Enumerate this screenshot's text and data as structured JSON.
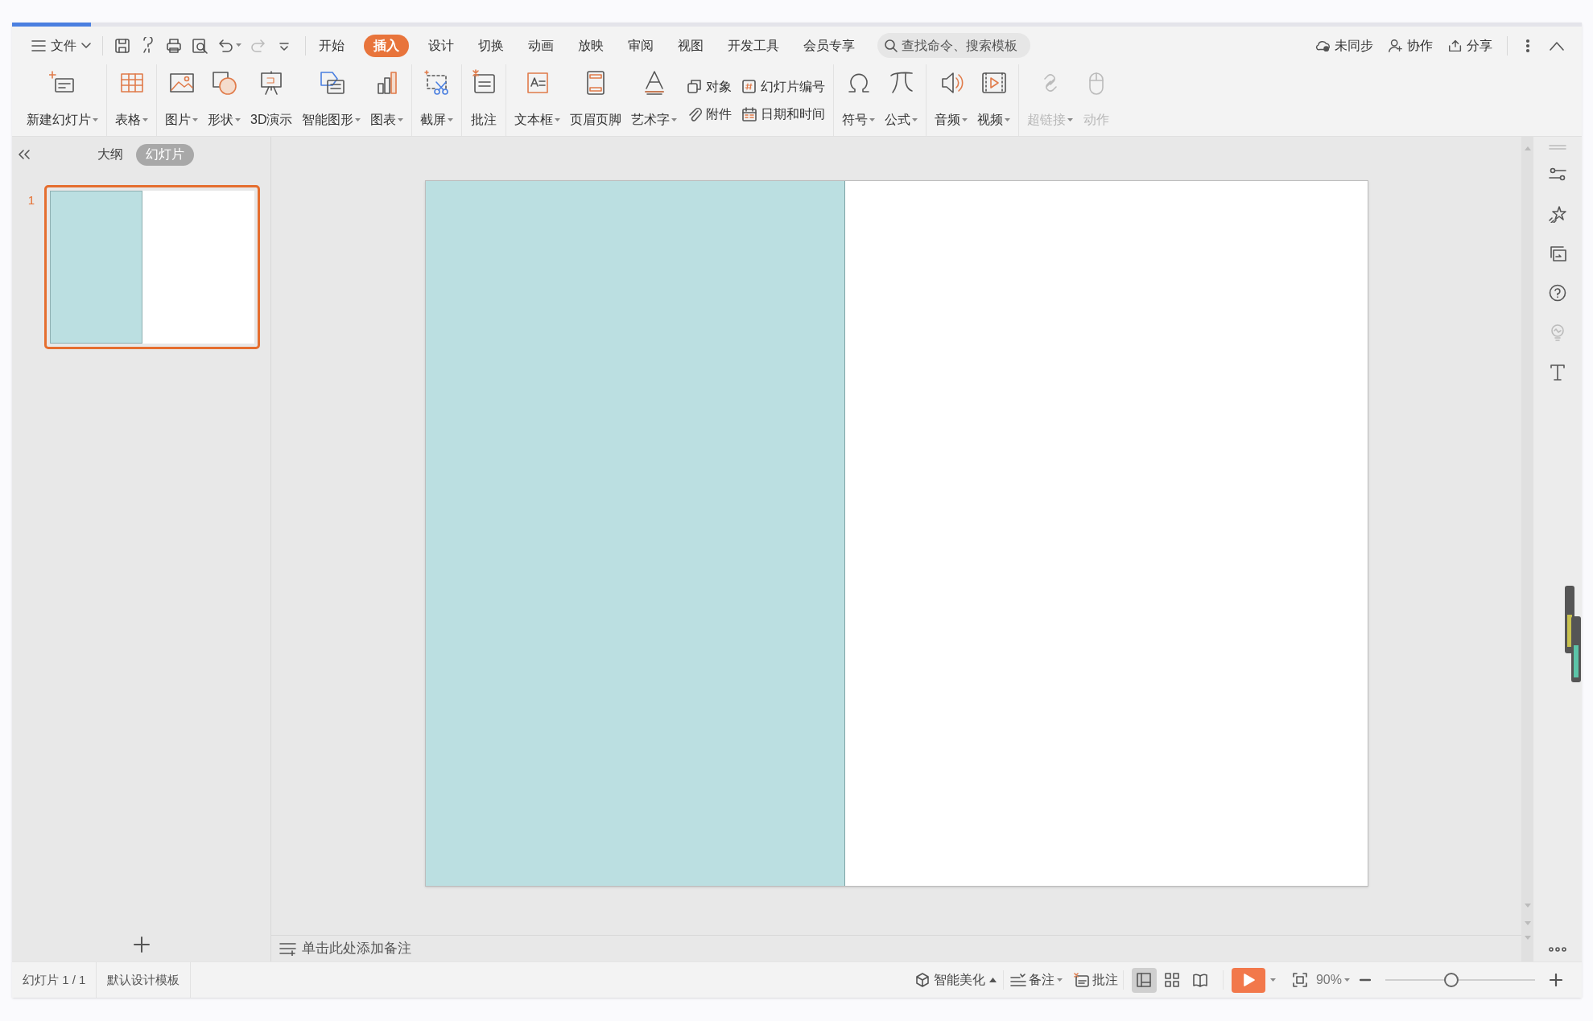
{
  "menu": {
    "file_label": "文件",
    "tabs": [
      {
        "label": "开始",
        "selected": false
      },
      {
        "label": "插入",
        "selected": true
      },
      {
        "label": "设计",
        "selected": false
      },
      {
        "label": "切换",
        "selected": false
      },
      {
        "label": "动画",
        "selected": false
      },
      {
        "label": "放映",
        "selected": false
      },
      {
        "label": "审阅",
        "selected": false
      },
      {
        "label": "视图",
        "selected": false
      },
      {
        "label": "开发工具",
        "selected": false
      },
      {
        "label": "会员专享",
        "selected": false
      }
    ],
    "search": {
      "placeholder": "查找命令、搜索模板"
    },
    "actions": [
      {
        "label": "未同步"
      },
      {
        "label": "协作"
      },
      {
        "label": "分享"
      }
    ]
  },
  "ribbon": {
    "groups": [
      {
        "items": [
          {
            "label": "新建幻灯片",
            "kind": "large",
            "dropdown": true,
            "disabled": false
          }
        ]
      },
      {
        "items": [
          {
            "label": "表格",
            "kind": "large",
            "dropdown": true,
            "disabled": false
          }
        ]
      },
      {
        "items": [
          {
            "label": "图片",
            "kind": "large",
            "dropdown": true,
            "disabled": false
          },
          {
            "label": "形状",
            "kind": "large",
            "dropdown": true,
            "disabled": false
          },
          {
            "label": "3D演示",
            "kind": "large",
            "dropdown": false,
            "disabled": false
          },
          {
            "label": "智能图形",
            "kind": "large",
            "dropdown": true,
            "disabled": false
          },
          {
            "label": "图表",
            "kind": "large",
            "dropdown": true,
            "disabled": false
          }
        ]
      },
      {
        "items": [
          {
            "label": "截屏",
            "kind": "large",
            "dropdown": true,
            "disabled": false
          }
        ]
      },
      {
        "items": [
          {
            "label": "批注",
            "kind": "large",
            "dropdown": false,
            "disabled": false
          }
        ]
      },
      {
        "items": [
          {
            "label": "文本框",
            "kind": "large",
            "dropdown": true,
            "disabled": false
          },
          {
            "label": "页眉页脚",
            "kind": "large",
            "dropdown": false,
            "disabled": false
          },
          {
            "label": "艺术字",
            "kind": "large",
            "dropdown": true,
            "disabled": false
          },
          {
            "label": "对象",
            "kind": "small",
            "dropdown": false,
            "disabled": false
          },
          {
            "label": "附件",
            "kind": "small",
            "dropdown": false,
            "disabled": false
          },
          {
            "label": "幻灯片编号",
            "kind": "small",
            "dropdown": false,
            "disabled": false
          },
          {
            "label": "日期和时间",
            "kind": "small",
            "dropdown": false,
            "disabled": false
          }
        ]
      },
      {
        "items": [
          {
            "label": "符号",
            "kind": "large",
            "dropdown": true,
            "disabled": false
          },
          {
            "label": "公式",
            "kind": "large",
            "dropdown": true,
            "disabled": false
          }
        ]
      },
      {
        "items": [
          {
            "label": "音频",
            "kind": "large",
            "dropdown": true,
            "disabled": false
          },
          {
            "label": "视频",
            "kind": "large",
            "dropdown": true,
            "disabled": false
          }
        ]
      },
      {
        "items": [
          {
            "label": "超链接",
            "kind": "large",
            "dropdown": true,
            "disabled": true
          },
          {
            "label": "动作",
            "kind": "large",
            "dropdown": false,
            "disabled": true
          }
        ]
      }
    ]
  },
  "slide_panel": {
    "tabs": [
      {
        "label": "大纲",
        "selected": false
      },
      {
        "label": "幻灯片",
        "selected": true
      }
    ],
    "thumbnails": [
      {
        "number": "1",
        "selected": true
      }
    ]
  },
  "notes": {
    "placeholder": "单击此处添加备注"
  },
  "status_bar": {
    "left": [
      "幻灯片 1 / 1",
      "默认设计模板"
    ],
    "beautify": "智能美化",
    "notes": "备注",
    "comments": "批注",
    "views": [
      {
        "selected": true
      },
      {
        "selected": false
      },
      {
        "selected": false
      }
    ],
    "zoom": {
      "reading": "90%",
      "level": 0.44
    }
  }
}
